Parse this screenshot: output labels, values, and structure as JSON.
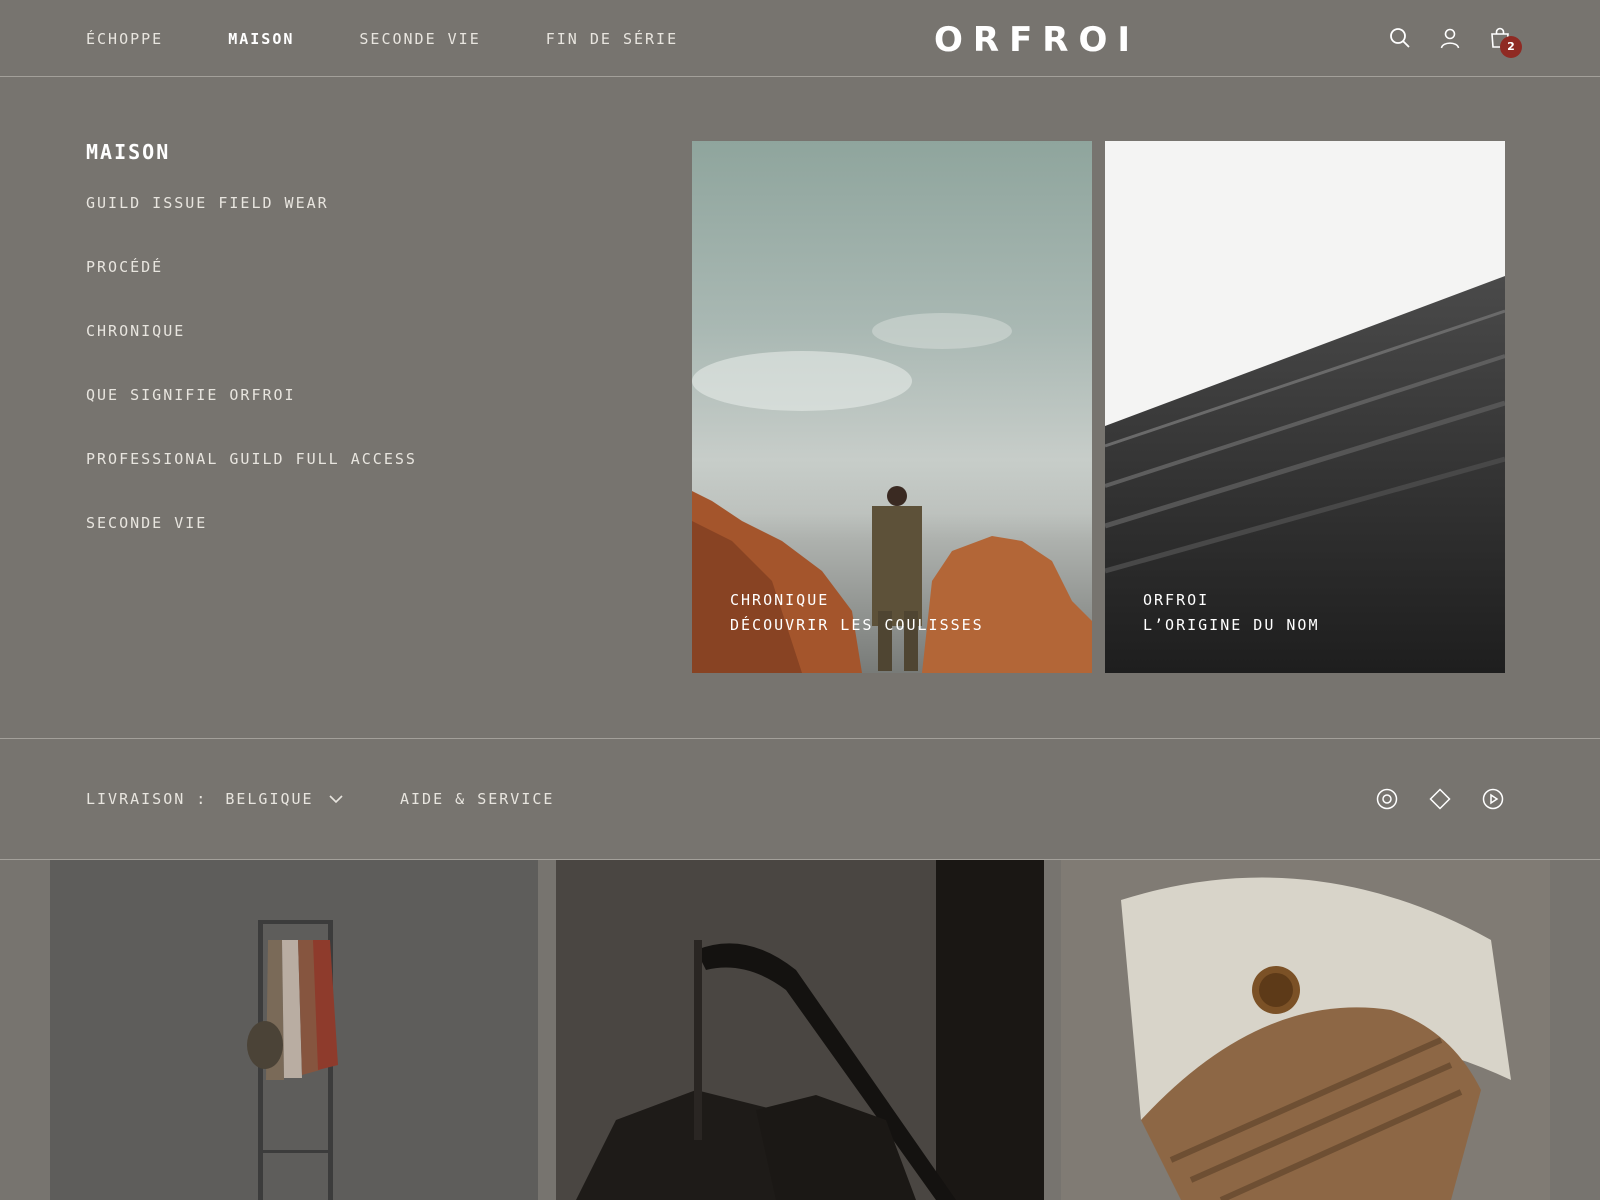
{
  "header": {
    "nav": [
      {
        "label": "ÉCHOPPE",
        "active": false
      },
      {
        "label": "MAISON",
        "active": true
      },
      {
        "label": "SECONDE VIE",
        "active": false
      },
      {
        "label": "FIN DE SÉRIE",
        "active": false
      }
    ],
    "logo": "ORFROI",
    "icons": [
      "search-icon",
      "account-icon",
      "cart-icon"
    ],
    "cart_count": "2"
  },
  "menu": {
    "title": "MAISON",
    "items": [
      "GUILD ISSUE FIELD WEAR",
      "PROCÉDÉ",
      "CHRONIQUE",
      "QUE SIGNIFIE ORFROI",
      "PROFESSIONAL GUILD FULL ACCESS",
      "SECONDE VIE"
    ]
  },
  "cards": [
    {
      "line1": "CHRONIQUE",
      "line2": "DÉCOUVRIR LES COULISSES"
    },
    {
      "line1": "ORFROI",
      "line2": "L’ORIGINE DU NOM"
    }
  ],
  "footer": {
    "shipping_label": "LIVRAISON :",
    "shipping_value": "BELGIQUE",
    "help": "AIDE & SERVICE",
    "social_icons": [
      "instagram-icon",
      "pinterest-icon",
      "youtube-icon"
    ]
  },
  "colors": {
    "overlay": "#77746f",
    "badge": "#8f2a23"
  }
}
